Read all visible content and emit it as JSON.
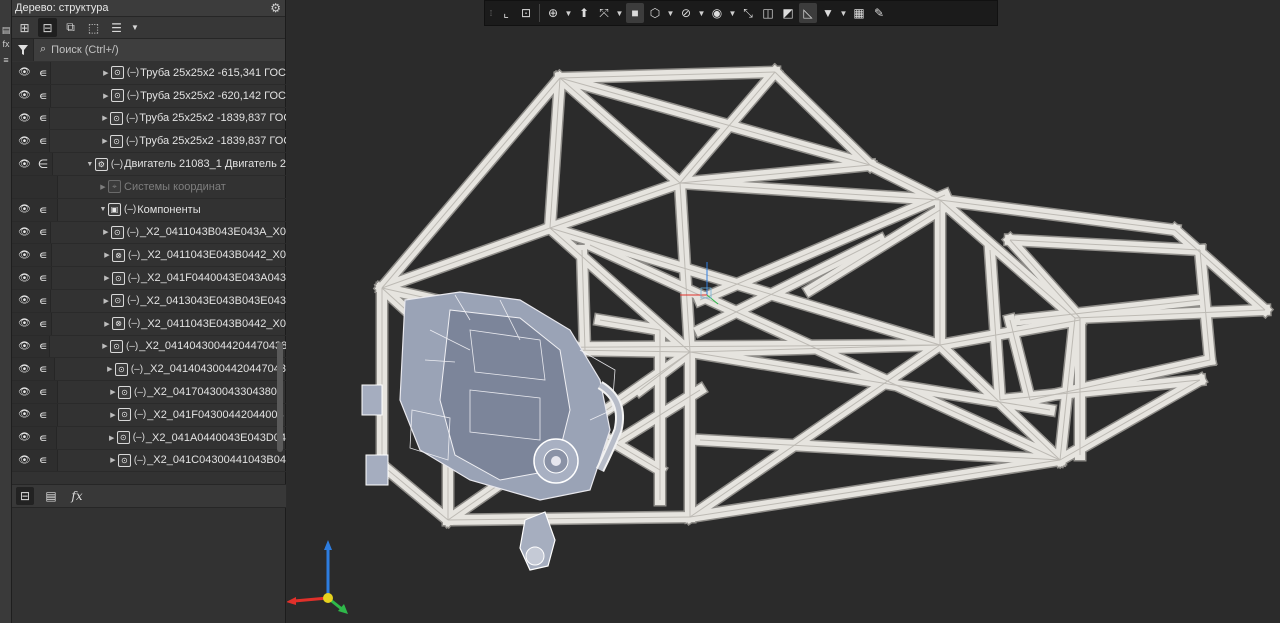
{
  "panel": {
    "title": "Дерево: структура",
    "search_placeholder": "Поиск (Ctrl+/)"
  },
  "tree_rows": [
    {
      "text": "Труба 25х25х2 -615,341 ГОС",
      "type": "part",
      "expanded": false
    },
    {
      "text": "Труба 25х25х2 -620,142 ГОС",
      "type": "part",
      "expanded": false
    },
    {
      "text": "Труба 25х25х2 -1839,837 ГОС",
      "type": "part",
      "expanded": false
    },
    {
      "text": "Труба 25х25х2 -1839,837 ГОС",
      "type": "part",
      "expanded": false
    },
    {
      "text": "Двигатель 21083_1 Двигатель 2",
      "type": "assembly",
      "expanded": true
    },
    {
      "text": "Системы координат",
      "type": "coords",
      "expanded": false
    },
    {
      "text": "Компоненты",
      "type": "components",
      "expanded": true
    },
    {
      "text": "_X2_0411043B043E043A_X0",
      "type": "part",
      "expanded": false
    },
    {
      "text": "_X2_0411043E043B0442_X0",
      "type": "part2",
      "expanded": false
    },
    {
      "text": "_X2_041F0440043E043A043",
      "type": "part",
      "expanded": false
    },
    {
      "text": "_X2_0413043E043B043E043",
      "type": "part",
      "expanded": false
    },
    {
      "text": "_X2_0411043E043B0442_X0",
      "type": "part2",
      "expanded": false
    },
    {
      "text": "_X2_04140430044204470438",
      "type": "part",
      "expanded": false
    },
    {
      "text": "_X2_0414043004420447043",
      "type": "part",
      "expanded": false
    },
    {
      "text": "_X2_041704300433043804",
      "type": "part",
      "expanded": false
    },
    {
      "text": "_X2_041F04300442044004",
      "type": "part",
      "expanded": false
    },
    {
      "text": "_X2_041A0440043E043D04",
      "type": "part",
      "expanded": false
    },
    {
      "text": "_X2_041C04300441043B04",
      "type": "part",
      "expanded": false
    }
  ],
  "icons": {
    "eye": "eye-icon",
    "include": "include-icon",
    "gear": "gear-icon",
    "filter": "filter-icon",
    "search": "search-icon"
  },
  "colors": {
    "frame_fill": "#e6e4df",
    "frame_edge": "#8f8d89",
    "background": "#2b2b2b",
    "axis_x": "#e0302a",
    "axis_y": "#2fb84a",
    "axis_z": "#2d7de0"
  }
}
